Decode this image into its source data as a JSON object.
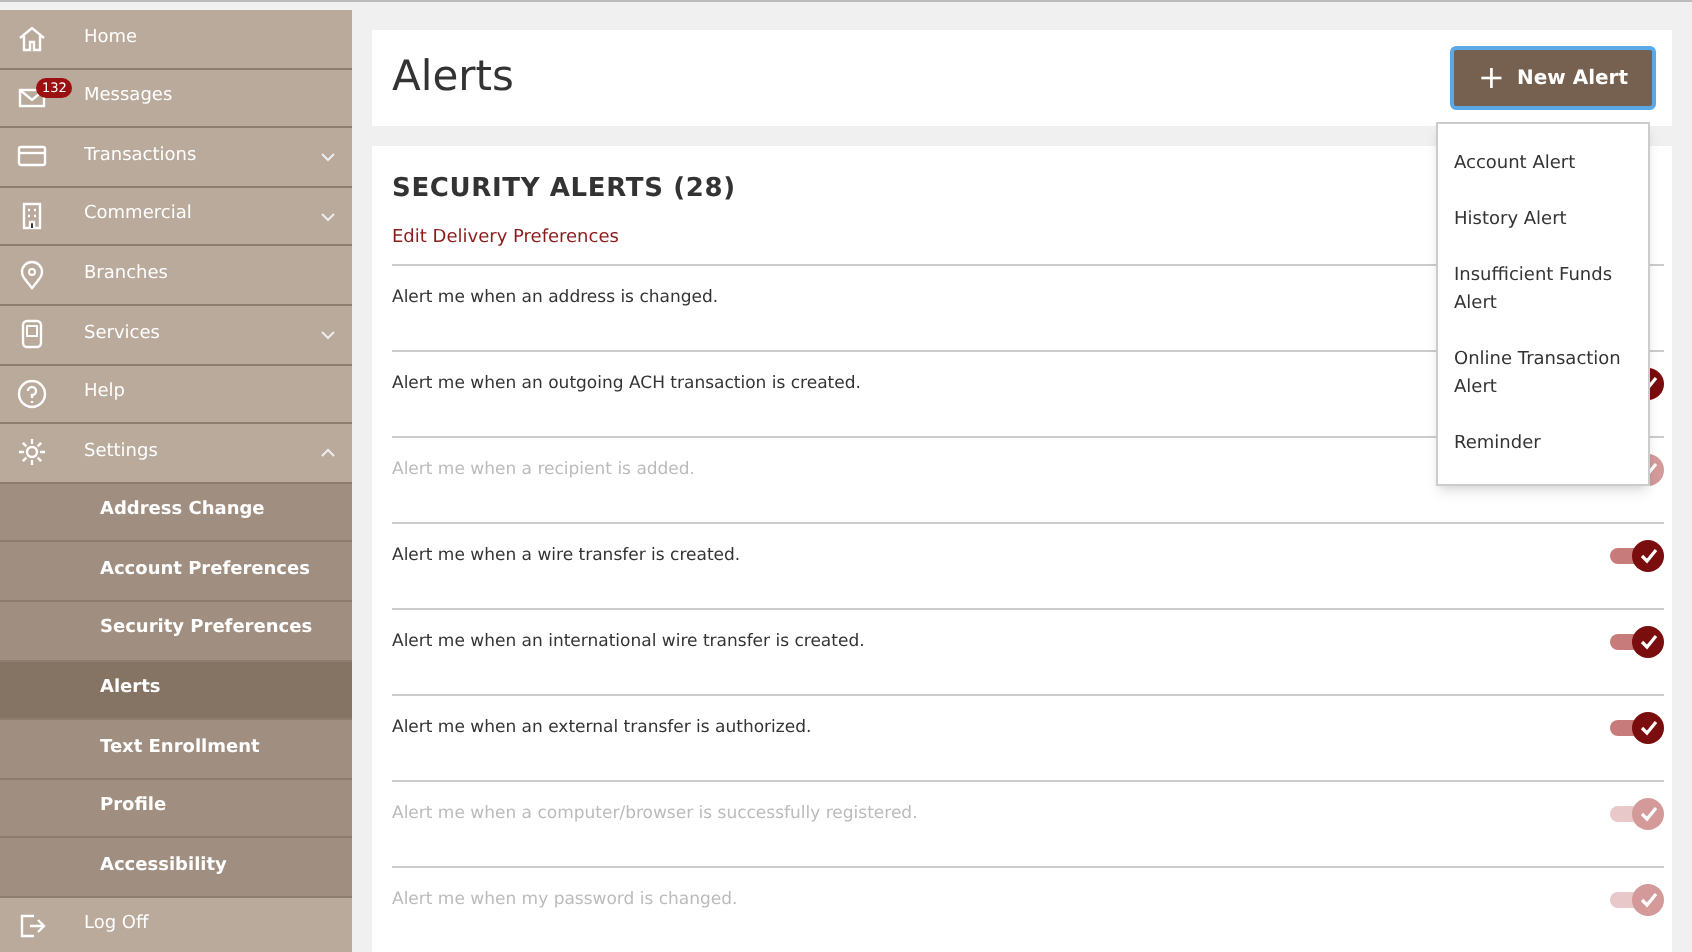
{
  "sidebar": {
    "items": [
      {
        "label": "Home",
        "selected": false
      },
      {
        "label": "Messages",
        "badge": "132",
        "selected": false
      },
      {
        "label": "Transactions",
        "expanded": false,
        "selected": false
      },
      {
        "label": "Commercial",
        "expanded": false,
        "selected": false
      },
      {
        "label": "Branches",
        "selected": false
      },
      {
        "label": "Services",
        "expanded": false,
        "selected": false
      },
      {
        "label": "Help",
        "selected": false
      },
      {
        "label": "Settings",
        "expanded": true,
        "selected": false,
        "children": [
          {
            "label": "Address Change",
            "selected": false
          },
          {
            "label": "Account Preferences",
            "selected": false
          },
          {
            "label": "Security Preferences",
            "selected": false
          },
          {
            "label": "Alerts",
            "selected": true
          },
          {
            "label": "Text Enrollment",
            "selected": false
          },
          {
            "label": "Profile",
            "selected": false
          },
          {
            "label": "Accessibility",
            "selected": false
          }
        ]
      },
      {
        "label": "Log Off",
        "selected": false
      }
    ]
  },
  "header": {
    "title": "Alerts",
    "button": {
      "icon": "+",
      "label": "New Alert"
    }
  },
  "menu": {
    "items": [
      "Account Alert",
      "History Alert",
      "Insufficient Funds Alert",
      "Online Transaction Alert",
      "Reminder"
    ]
  },
  "section": {
    "title": "SECURITY ALERTS (28)",
    "link": "Edit Delivery Preferences",
    "alerts": [
      {
        "text": "Alert me when an address is changed.",
        "disabled": false
      },
      {
        "text": "Alert me when an outgoing ACH transaction is created.",
        "disabled": false,
        "on": true
      },
      {
        "text": "Alert me when a recipient is added.",
        "disabled": true,
        "on": true
      },
      {
        "text": "Alert me when a wire transfer is created.",
        "disabled": false,
        "on": true
      },
      {
        "text": "Alert me when an international wire transfer is created.",
        "disabled": false,
        "on": true
      },
      {
        "text": "Alert me when an external transfer is authorized.",
        "disabled": false,
        "on": true
      },
      {
        "text": "Alert me when a computer/browser is successfully registered.",
        "disabled": true,
        "on": true
      },
      {
        "text": "Alert me when my password is changed.",
        "disabled": true,
        "on": true
      }
    ]
  }
}
